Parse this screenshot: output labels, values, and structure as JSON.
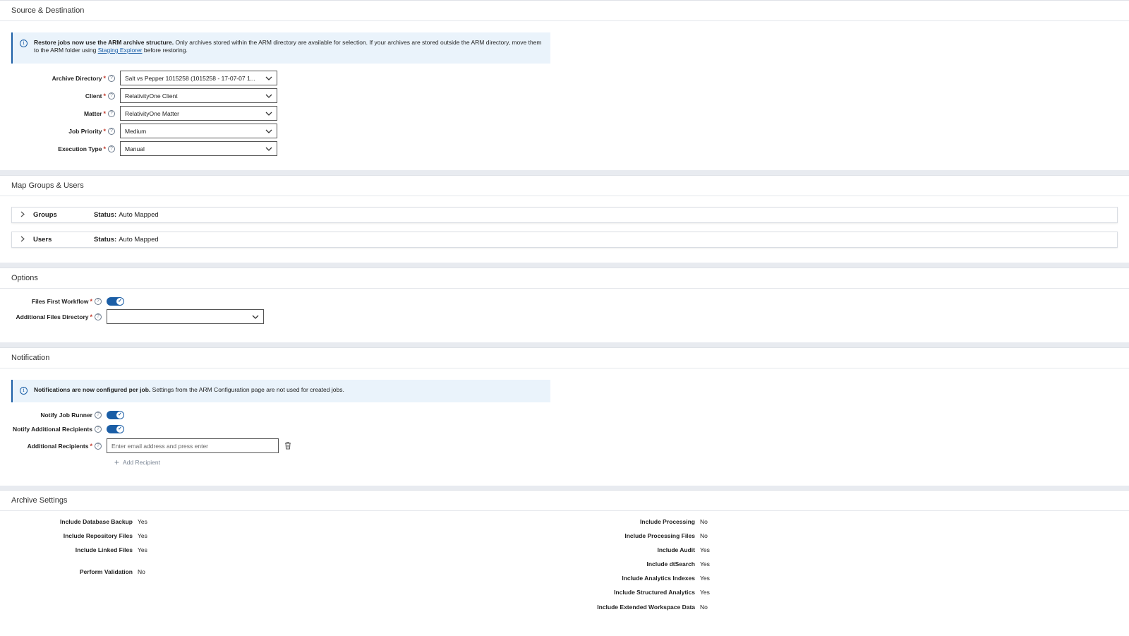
{
  "source": {
    "title": "Source & Destination",
    "banner_bold": "Restore jobs now use the ARM archive structure.",
    "banner_text_1": " Only archives stored within the ARM directory are available for selection. If your archives are stored outside the ARM directory, move them to the ARM folder using ",
    "banner_link": "Staging Explorer",
    "banner_text_2": " before restoring.",
    "fields": [
      {
        "label": "Archive Directory",
        "value": "Salt vs Pepper 1015258 (1015258 - 17-07-07 1..."
      },
      {
        "label": "Client",
        "value": "RelativityOne Client"
      },
      {
        "label": "Matter",
        "value": "RelativityOne Matter"
      },
      {
        "label": "Job Priority",
        "value": "Medium"
      },
      {
        "label": "Execution Type",
        "value": "Manual"
      }
    ]
  },
  "map": {
    "title": "Map Groups & Users",
    "status_label": "Status:",
    "rows": [
      {
        "label": "Groups",
        "status": "Auto Mapped"
      },
      {
        "label": "Users",
        "status": "Auto Mapped"
      }
    ]
  },
  "options": {
    "title": "Options",
    "files_first_label": "Files First Workflow",
    "files_first_on": true,
    "additional_dir_label": "Additional Files Directory",
    "additional_dir_value": ""
  },
  "notification": {
    "title": "Notification",
    "banner_bold": "Notifications are now configured per job.",
    "banner_text": " Settings from the ARM Configuration page are not used for created jobs.",
    "notify_runner_label": "Notify Job Runner",
    "notify_additional_label": "Notify Additional Recipients",
    "recipients_label": "Additional Recipients",
    "recipients_placeholder": "Enter email address and press enter",
    "add_recipient_label": "Add Recipient"
  },
  "archive": {
    "title": "Archive Settings",
    "left": [
      {
        "k": "Include Database Backup",
        "v": "Yes"
      },
      {
        "k": "Include Repository Files",
        "v": "Yes"
      },
      {
        "k": "Include Linked Files",
        "v": "Yes"
      },
      {
        "k": "Perform Validation",
        "v": "No"
      }
    ],
    "right": [
      {
        "k": "Include Processing",
        "v": "No"
      },
      {
        "k": "Include Processing Files",
        "v": "No"
      },
      {
        "k": "Include Audit",
        "v": "Yes"
      },
      {
        "k": "Include dtSearch",
        "v": "Yes"
      },
      {
        "k": "Include Analytics Indexes",
        "v": "Yes"
      },
      {
        "k": "Include Structured Analytics",
        "v": "Yes"
      },
      {
        "k": "Include Extended Workspace Data",
        "v": "No"
      }
    ]
  },
  "colors": {
    "accent": "#1b5ea6",
    "required": "#c0392b",
    "banner_bg": "#eaf3fb"
  }
}
